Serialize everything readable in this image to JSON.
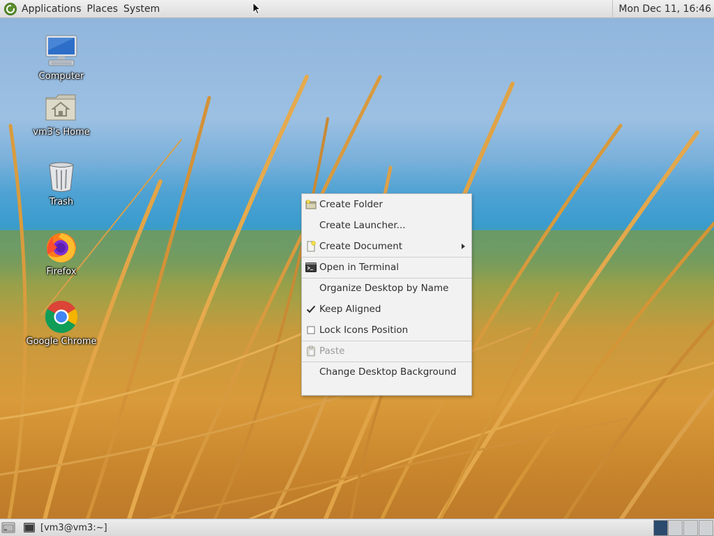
{
  "top_panel": {
    "menus": [
      "Applications",
      "Places",
      "System"
    ],
    "clock": "Mon Dec 11, 16:46"
  },
  "desktop_icons": [
    {
      "label": "Computer",
      "icon": "computer-icon"
    },
    {
      "label": "vm3's Home",
      "icon": "home-folder-icon"
    },
    {
      "label": "Trash",
      "icon": "trash-icon"
    },
    {
      "label": "Firefox",
      "icon": "firefox-icon"
    },
    {
      "label": "Google Chrome",
      "icon": "chrome-icon"
    }
  ],
  "context_menu": {
    "items": [
      {
        "label": "Create Folder",
        "icon": "folder-new-icon",
        "enabled": true
      },
      {
        "label": "Create Launcher...",
        "enabled": true
      },
      {
        "label": "Create Document",
        "icon": "document-new-icon",
        "enabled": true,
        "submenu": true
      },
      {
        "label": "Open in Terminal",
        "icon": "terminal-icon",
        "enabled": true
      },
      {
        "label": "Organize Desktop by Name",
        "enabled": true
      },
      {
        "label": "Keep Aligned",
        "checked": true,
        "enabled": true
      },
      {
        "label": "Lock Icons Position",
        "checked": false,
        "enabled": true
      },
      {
        "label": "Paste",
        "icon": "paste-icon",
        "enabled": false
      },
      {
        "label": "Change Desktop Background",
        "enabled": true
      }
    ]
  },
  "bottom_panel": {
    "taskbar_item": "[vm3@vm3:~]",
    "workspaces": 4,
    "active_workspace": 1
  },
  "colors": {
    "panel_bg": "#e3e3e3",
    "menu_bg": "#f2f2f2",
    "disabled_text": "#9a9a9a",
    "active_workspace": "#2a4a6e"
  }
}
